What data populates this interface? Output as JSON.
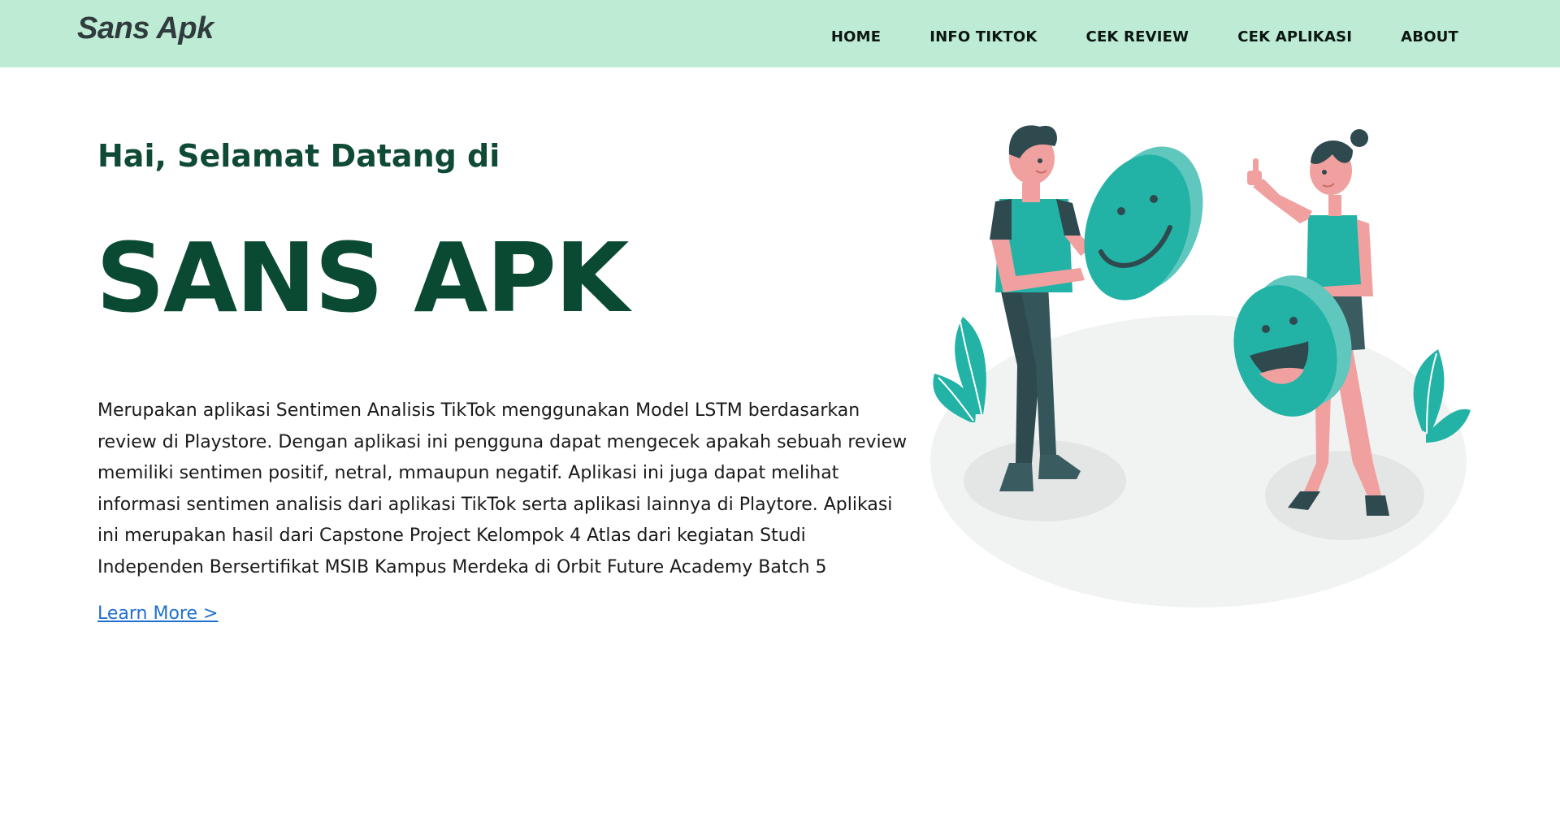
{
  "brand": "Sans Apk",
  "nav": {
    "items": [
      {
        "label": "HOME"
      },
      {
        "label": "INFO TIKTOK"
      },
      {
        "label": "CEK REVIEW"
      },
      {
        "label": "CEK APLIKASI"
      },
      {
        "label": "ABOUT"
      }
    ]
  },
  "hero": {
    "greeting": "Hai, Selamat Datang di",
    "title": "SANS APK",
    "description": "Merupakan aplikasi Sentimen Analisis TikTok menggunakan Model LSTM berdasarkan review di Playstore. Dengan aplikasi ini pengguna dapat mengecek apakah sebuah review memiliki sentimen positif, netral, mmaupun negatif. Aplikasi ini juga dapat melihat informasi sentimen analisis dari aplikasi TikTok serta aplikasi lainnya di Playtore. Aplikasi ini merupakan hasil dari Capstone Project Kelompok 4 Atlas dari kegiatan Studi Independen Bersertifikat MSIB Kampus Merdeka di Orbit Future Academy Batch 5",
    "learn_more": "Learn More >"
  },
  "colors": {
    "navbar_bg": "#bdebd3",
    "heading": "#0a4a33",
    "link": "#1f6fd0",
    "teal": "#22b3a6"
  },
  "illustration": {
    "icon": "people-with-smiley-faces-illustration"
  }
}
